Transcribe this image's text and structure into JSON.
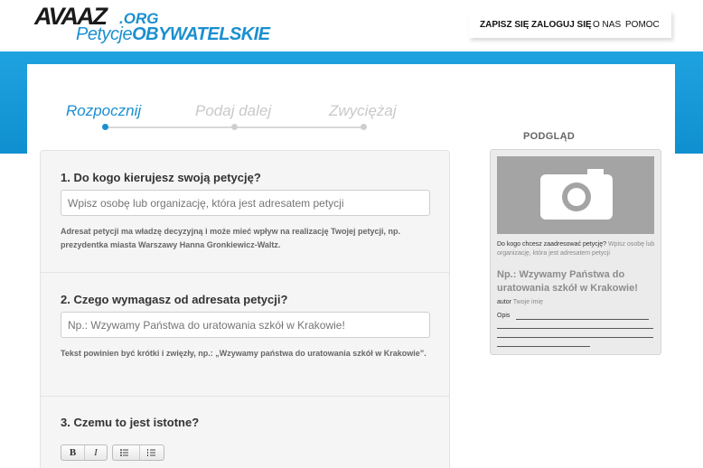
{
  "logo": {
    "main": "AVAAZ",
    "org": ".ORG",
    "sub_light": "Petycje",
    "sub_bold": "OBYWATELSKIE"
  },
  "nav": [
    {
      "label": "ZAPISZ SIĘ"
    },
    {
      "label": "ZALOGUJ SIĘ"
    },
    {
      "label": "O NAS"
    },
    {
      "label": "POMOC"
    }
  ],
  "steps": [
    {
      "label": "Rozpocznij",
      "active": true
    },
    {
      "label": "Podaj dalej",
      "active": false
    },
    {
      "label": "Zwyciężaj",
      "active": false
    }
  ],
  "form": {
    "q1": {
      "label": "1. Do kogo kierujesz swoją petycję?",
      "placeholder": "Wpisz osobę lub organizację, która jest adresatem petycji",
      "hint": "Adresat petycji ma władzę decyzyjną i może mieć wpływ na realizację Twojej petycji, np. prezydentka miasta Warszawy Hanna Gronkiewicz-Waltz."
    },
    "q2": {
      "label": "2. Czego wymagasz od adresata petycji?",
      "placeholder": "Np.: Wzywamy Państwa do uratowania szkół w Krakowie!",
      "hint": "Tekst powinien być krótki i zwięzły, np.: „Wzywamy państwa do uratowania szkół w Krakowie”."
    },
    "q3": {
      "label": "3. Czemu to jest istotne?"
    },
    "toolbar": {
      "bold": "B",
      "italic": "I",
      "bullets": "☰",
      "numbers": "≡"
    }
  },
  "preview": {
    "title": "PODGLĄD",
    "to_label": "Do kogo chcesz zaadresować petycję?",
    "to_placeholder": "Wpisz osobę lub organizację, która jest adresatem petycji",
    "headline": "Np.: Wzywamy Państwa do uratowania szkół w Krakowie!",
    "author_label": "autor",
    "author_value": "Twoje imię",
    "desc_label": "Opis"
  },
  "colors": {
    "brand_blue": "#1a8fd0",
    "band_blue": "#1fa3df"
  },
  "icons": {
    "camera": "camera-icon"
  }
}
